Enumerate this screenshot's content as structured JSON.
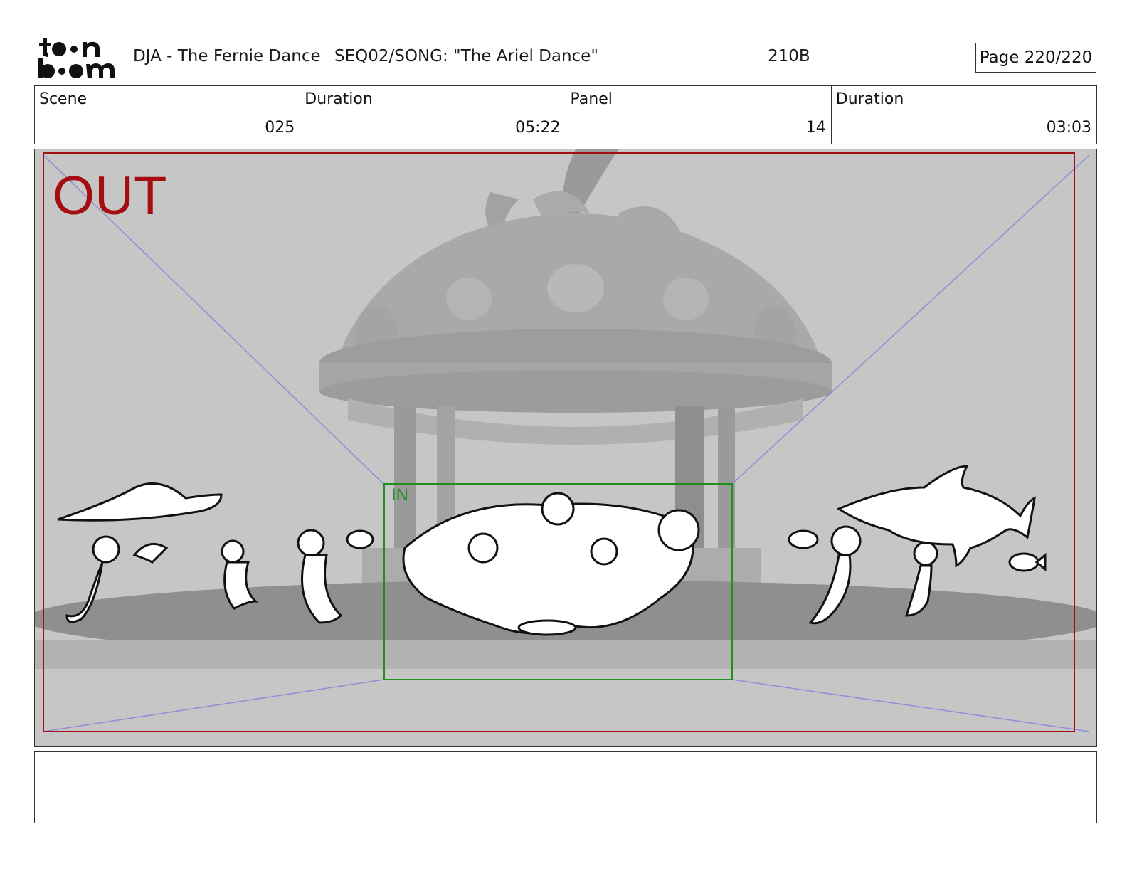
{
  "header": {
    "project": "DJA - The Fernie Dance",
    "sequence": "SEQ02/SONG: \"The Ariel Dance\"",
    "shot_code": "210B",
    "page": "Page 220/220"
  },
  "info": {
    "scene_label": "Scene",
    "scene_value": "025",
    "scene_duration_label": "Duration",
    "scene_duration_value": "05:22",
    "panel_label": "Panel",
    "panel_value": "14",
    "panel_duration_label": "Duration",
    "panel_duration_value": "03:03"
  },
  "panel_frame": {
    "out_label": "OUT",
    "in_label": "IN",
    "out_frame_color": "#a50d12",
    "in_frame_color": "#1f8f1f",
    "guide_color": "#8a8fd6"
  },
  "notes": {
    "text": ""
  }
}
